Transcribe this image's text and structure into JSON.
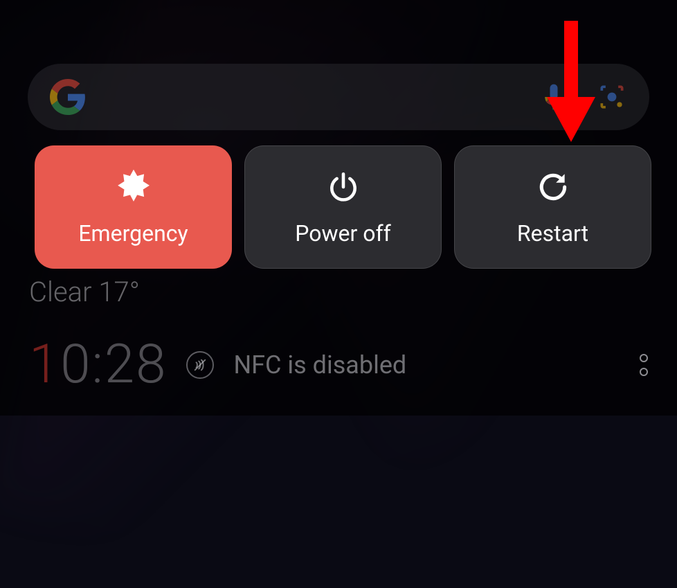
{
  "search": {
    "placeholder": ""
  },
  "power_menu": {
    "emergency": {
      "label": "Emergency"
    },
    "power_off": {
      "label": "Power off"
    },
    "restart": {
      "label": "Restart"
    }
  },
  "weather": {
    "text": "Clear 17°"
  },
  "clock": {
    "accent_digit": "1",
    "rest": "0:28"
  },
  "nfc": {
    "status_text": "NFC is disabled"
  },
  "colors": {
    "emergency": "#e8594f",
    "dark_button": "#2c2c30",
    "arrow": "#ff0000"
  }
}
